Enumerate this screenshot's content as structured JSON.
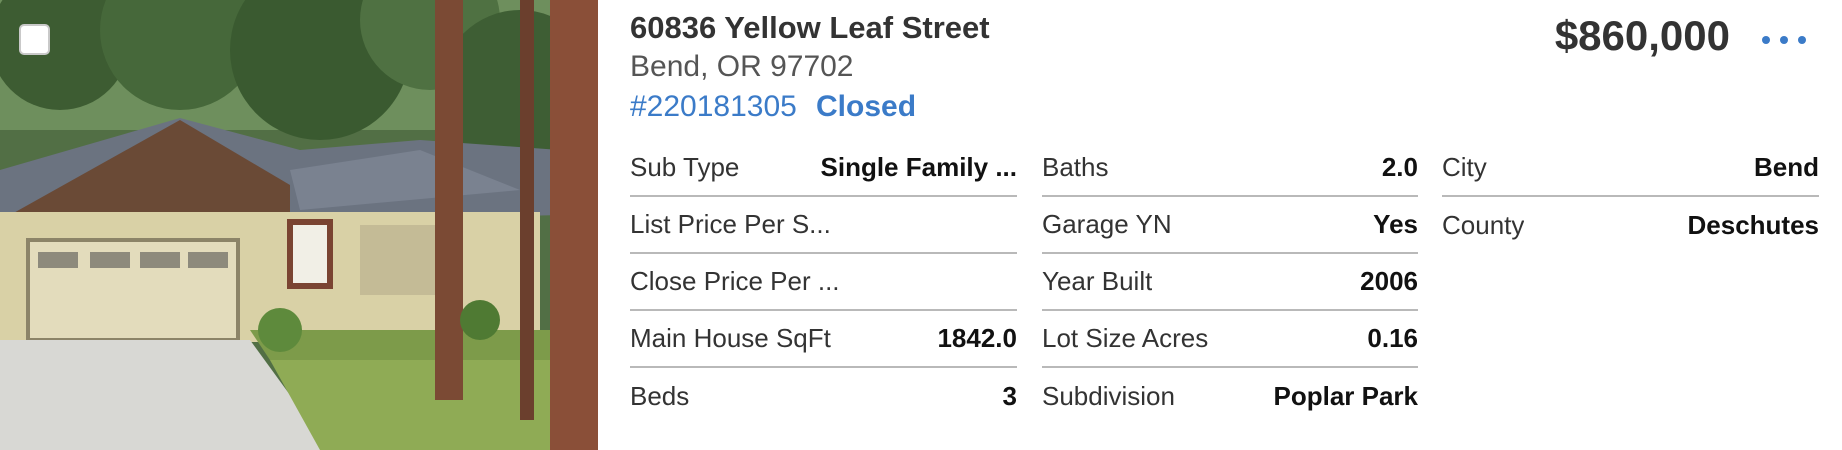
{
  "listing": {
    "address": "60836 Yellow Leaf Street",
    "city_state_zip": "Bend, OR 97702",
    "mls_number": "#220181305",
    "status": "Closed",
    "price": "$860,000",
    "more_icon": "more-horizontal-icon",
    "photo_checkbox": "checkbox-icon"
  },
  "colors": {
    "accent": "#3b7bc8",
    "text": "#333333",
    "divider": "#b9b9b9"
  },
  "details": {
    "col1": [
      {
        "label": "Sub Type",
        "value": "Single Family ..."
      },
      {
        "label": "List Price Per S...",
        "value": ""
      },
      {
        "label": "Close Price Per ...",
        "value": ""
      },
      {
        "label": "Main House SqFt",
        "value": "1842.0"
      },
      {
        "label": "Beds",
        "value": "3"
      }
    ],
    "col2": [
      {
        "label": "Baths",
        "value": "2.0"
      },
      {
        "label": "Garage YN",
        "value": "Yes"
      },
      {
        "label": "Year Built",
        "value": "2006"
      },
      {
        "label": "Lot Size Acres",
        "value": "0.16"
      },
      {
        "label": "Subdivision",
        "value": "Poplar Park"
      }
    ],
    "col3": [
      {
        "label": "City",
        "value": "Bend"
      },
      {
        "label": "County",
        "value": "Deschutes"
      }
    ]
  }
}
